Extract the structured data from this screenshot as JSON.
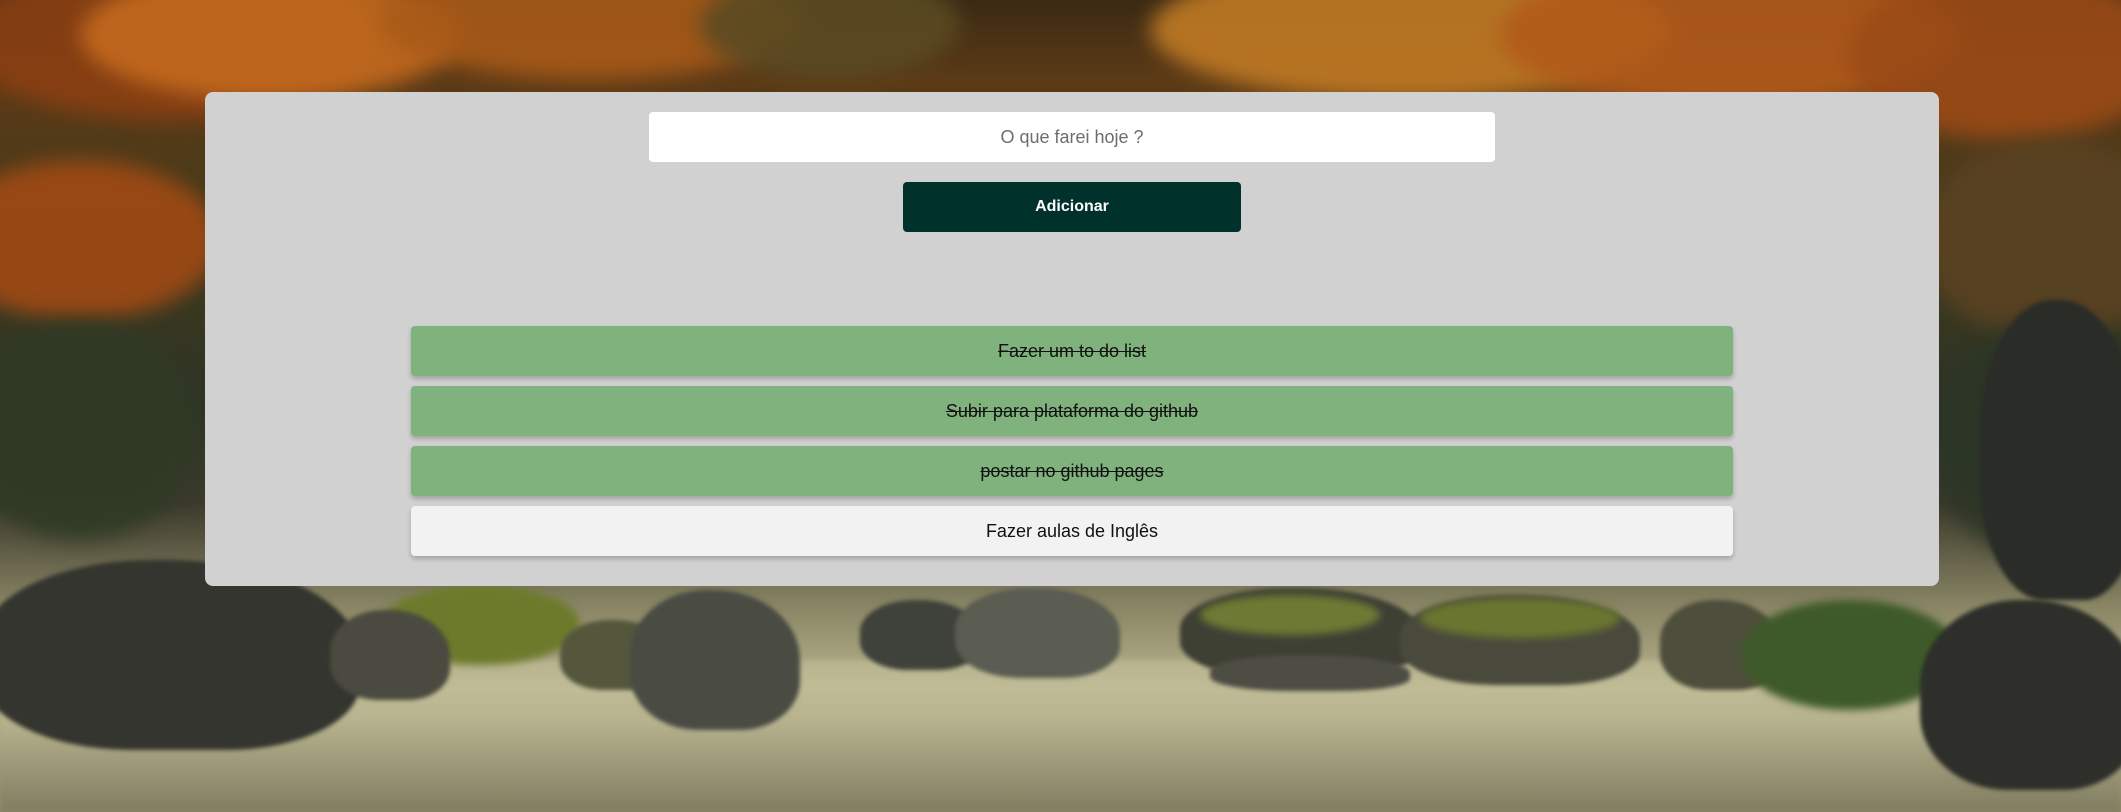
{
  "todo": {
    "input_placeholder": "O que farei hoje ?",
    "input_value": "",
    "add_button_label": "Adicionar",
    "tasks": [
      {
        "label": "Fazer um to do list",
        "done": true
      },
      {
        "label": "Subir para plataforma do github",
        "done": true
      },
      {
        "label": "postar no github pages",
        "done": true
      },
      {
        "label": "Fazer aulas de Inglês",
        "done": false
      }
    ]
  },
  "colors": {
    "card_background": "#d1d1d1",
    "button_background": "#01312b",
    "done_task_background": "#80b27e",
    "pending_task_background": "#f2f2f2"
  }
}
